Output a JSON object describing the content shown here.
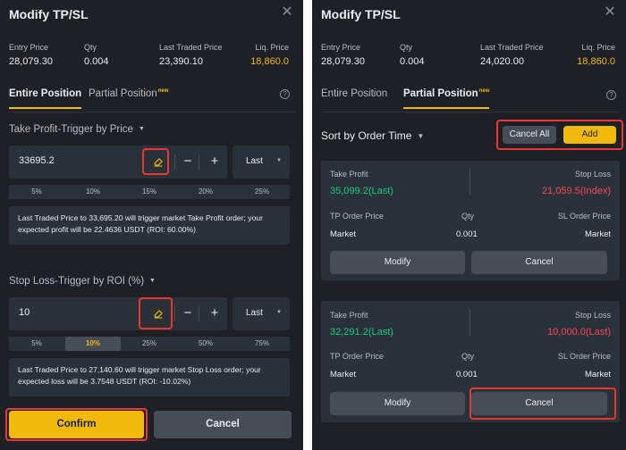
{
  "left": {
    "title": "Modify TP/SL",
    "close_glyph": "✕",
    "stats": {
      "entry_label": "Entry Price",
      "entry_value": "28,079.30",
      "qty_label": "Qty",
      "qty_value": "0.004",
      "last_label": "Last Traded Price",
      "last_value": "23,390.10",
      "liq_label": "Liq. Price",
      "liq_value": "18,860.0"
    },
    "tabs": {
      "entire": "Entire Position",
      "partial": "Partial Position",
      "badge": "new"
    },
    "help_glyph": "?",
    "take_profit": {
      "title": "Take Profit-Trigger by Price",
      "value": "33695.2",
      "minus": "−",
      "plus": "+",
      "select": "Last",
      "pcts": [
        "5%",
        "10%",
        "15%",
        "20%",
        "25%"
      ],
      "info": "Last Traded Price to 33,695.20 will trigger market Take Profit order; your expected profit will be 22.4636 USDT (ROI: 60.00%)"
    },
    "stop_loss": {
      "title": "Stop Loss-Trigger by ROI (%)",
      "value": "10",
      "minus": "−",
      "plus": "+",
      "select": "Last",
      "pcts": [
        "5%",
        "10%",
        "25%",
        "50%",
        "75%"
      ],
      "active_pct_index": 1,
      "info": "Last Traded Price to 27,140.60 will trigger market Stop Loss order; your expected loss will be 3.7548 USDT (ROI: -10.02%)"
    },
    "confirm_label": "Confirm",
    "cancel_label": "Cancel"
  },
  "right": {
    "title": "Modify TP/SL",
    "close_glyph": "✕",
    "stats": {
      "entry_label": "Entry Price",
      "entry_value": "28,079.30",
      "qty_label": "Qty",
      "qty_value": "0.004",
      "last_label": "Last Traded Price",
      "last_value": "24,020.00",
      "liq_label": "Liq. Price",
      "liq_value": "18,860.0"
    },
    "tabs": {
      "entire": "Entire Position",
      "partial": "Partial Position",
      "badge": "new"
    },
    "help_glyph": "?",
    "sort_label": "Sort by Order Time",
    "cancel_all_label": "Cancel All",
    "add_label": "Add",
    "orders": [
      {
        "tp_label": "Take Profit",
        "tp_value": "35,099.2(Last)",
        "sl_label": "Stop Loss",
        "sl_value": "21,059.5(Index)",
        "tp_price_label": "TP Order Price",
        "qty_label": "Qty",
        "sl_price_label": "SL Order Price",
        "tp_price": "Market",
        "qty": "0.001",
        "sl_price": "Market",
        "modify_label": "Modify",
        "cancel_label": "Cancel"
      },
      {
        "tp_label": "Take Profit",
        "tp_value": "32,291.2(Last)",
        "sl_label": "Stop Loss",
        "sl_value": "10,000.0(Last)",
        "tp_price_label": "TP Order Price",
        "qty_label": "Qty",
        "sl_price_label": "SL Order Price",
        "tp_price": "Market",
        "qty": "0.001",
        "sl_price": "Market",
        "modify_label": "Modify",
        "cancel_label": "Cancel"
      }
    ]
  },
  "colors": {
    "panel_bg": "#1e2026",
    "input_bg": "#2b3139",
    "accent": "#f0b90b",
    "profit": "#0ecb81",
    "loss": "#f6465d",
    "highlight_ring": "#e53935"
  },
  "icons": [
    "close-icon",
    "help-icon",
    "eraser-icon",
    "chevron-down-icon"
  ]
}
